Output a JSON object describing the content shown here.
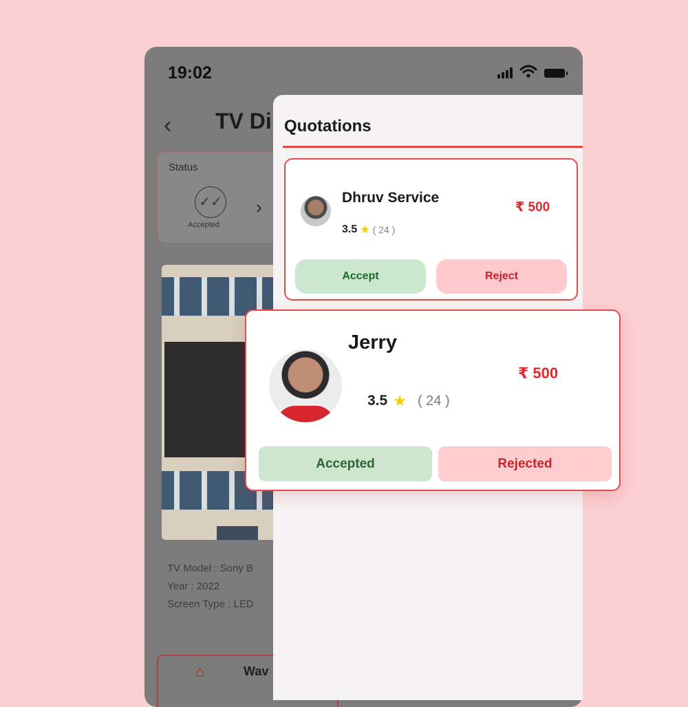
{
  "status_bar": {
    "time": "19:02"
  },
  "background_screen": {
    "title": "TV Di",
    "status_card": {
      "label": "Status",
      "value": "Accepted"
    },
    "specs": [
      "TV Model : Sony B",
      "Year : 2022",
      "Screen Type : LED"
    ],
    "bottom_nav": {
      "label": "Wav"
    }
  },
  "sheet": {
    "title": "Quotations"
  },
  "quotations": [
    {
      "name": "Dhruv Service",
      "price": "₹ 500",
      "rating": "3.5",
      "reviews": "( 24 )",
      "accept_label": "Accept",
      "reject_label": "Reject"
    },
    {
      "name": "Jerry",
      "price": "₹ 500",
      "rating": "3.5",
      "reviews": "( 24 )",
      "accept_label": "Accepted",
      "reject_label": "Rejected"
    }
  ],
  "icons": {
    "back": "chevron-left-icon",
    "status": "double-check-icon",
    "next": "chevron-right-icon",
    "rating": "star-icon",
    "home": "home-icon",
    "wifi": "wifi-icon",
    "signal": "signal-icon",
    "battery": "battery-icon"
  },
  "colors": {
    "accent": "#e84b4b",
    "price": "#e2282c",
    "accept_bg": "#cbe7cd",
    "reject_bg": "#ffc9cd",
    "page_bg": "#fbd0d3"
  }
}
